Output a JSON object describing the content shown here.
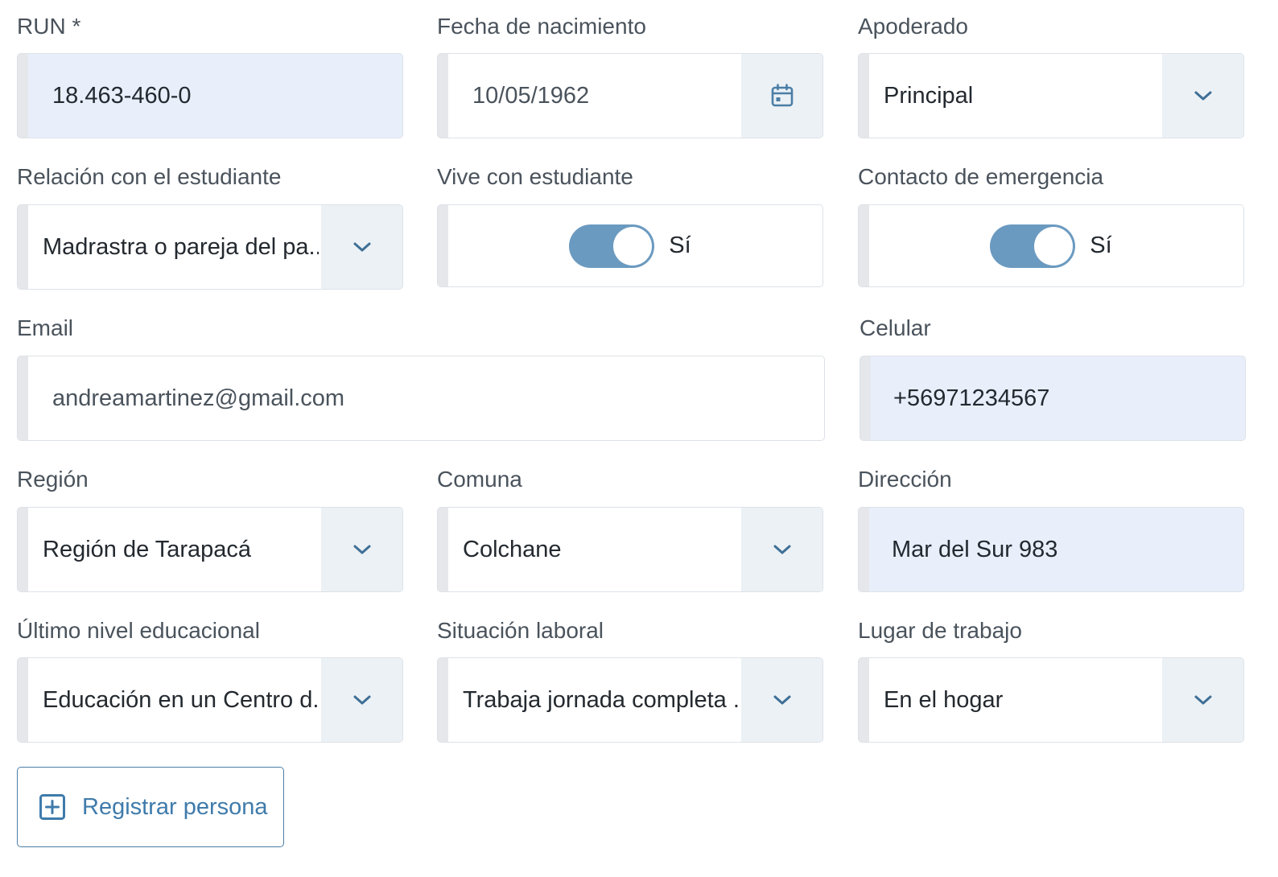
{
  "fields": {
    "run": {
      "label": "RUN *",
      "value": "18.463-460-0"
    },
    "birthdate": {
      "label": "Fecha de nacimiento",
      "value": "10/05/1962",
      "icon": "calendar-icon"
    },
    "guardian": {
      "label": "Apoderado",
      "value": "Principal"
    },
    "relation": {
      "label": "Relación con el estudiante",
      "value": "Madrastra o pareja del pa..."
    },
    "lives_with": {
      "label": "Vive con estudiante",
      "state": "on",
      "state_text": "Sí"
    },
    "emergency": {
      "label": "Contacto de emergencia",
      "state": "on",
      "state_text": "Sí"
    },
    "email": {
      "label": "Email",
      "value": "andreamartinez@gmail.com"
    },
    "phone": {
      "label": "Celular",
      "value": "+56971234567"
    },
    "region": {
      "label": "Región",
      "value": "Región de Tarapacá"
    },
    "commune": {
      "label": "Comuna",
      "value": "Colchane"
    },
    "address": {
      "label": "Dirección",
      "value": "Mar del Sur 983"
    },
    "education": {
      "label": "Último nivel educacional",
      "value": "Educación en un Centro d..."
    },
    "employment": {
      "label": "Situación laboral",
      "value": "Trabaja jornada completa ..."
    },
    "workplace": {
      "label": "Lugar de trabajo",
      "value": "En el hogar"
    }
  },
  "register_button": {
    "label": "Registrar persona",
    "icon": "plus-square-icon"
  },
  "colors": {
    "accent": "#3f7bab",
    "toggle_on": "#6b9ac0",
    "filled_bg": "#e8effb",
    "addon_bg": "#ebf1f5"
  }
}
